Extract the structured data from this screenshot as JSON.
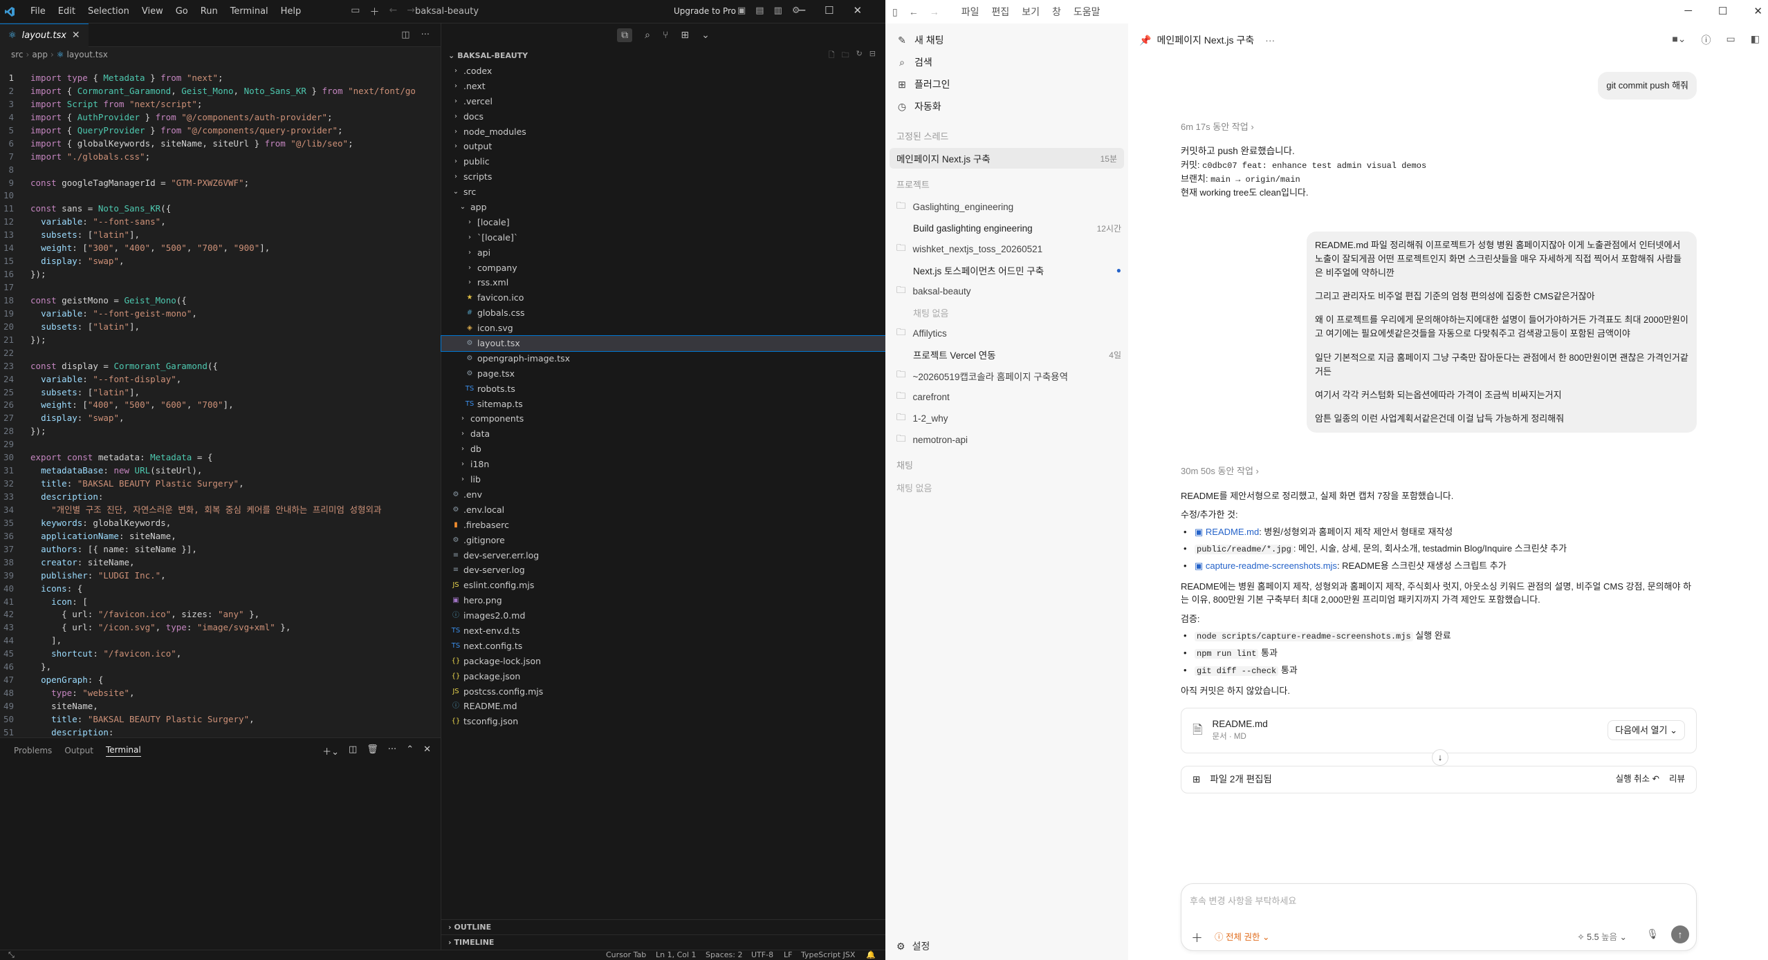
{
  "vscode": {
    "menu": [
      "File",
      "Edit",
      "Selection",
      "View",
      "Go",
      "Run",
      "Terminal",
      "Help"
    ],
    "window_title": "baksal-beauty",
    "upgrade": "Upgrade to Pro",
    "tab": "layout.tsx",
    "breadcrumb": [
      "src",
      "app",
      "layout.tsx"
    ],
    "code_lines": [
      "import type { Metadata } from \"next\";",
      "import { Cormorant_Garamond, Geist_Mono, Noto_Sans_KR } from \"next/font/go",
      "import Script from \"next/script\";",
      "import { AuthProvider } from \"@/components/auth-provider\";",
      "import { QueryProvider } from \"@/components/query-provider\";",
      "import { globalKeywords, siteName, siteUrl } from \"@/lib/seo\";",
      "import \"./globals.css\";",
      "",
      "const googleTagManagerId = \"GTM-PXWZ6VWF\";",
      "",
      "const sans = Noto_Sans_KR({",
      "  variable: \"--font-sans\",",
      "  subsets: [\"latin\"],",
      "  weight: [\"300\", \"400\", \"500\", \"700\", \"900\"],",
      "  display: \"swap\",",
      "});",
      "",
      "const geistMono = Geist_Mono({",
      "  variable: \"--font-geist-mono\",",
      "  subsets: [\"latin\"],",
      "});",
      "",
      "const display = Cormorant_Garamond({",
      "  variable: \"--font-display\",",
      "  subsets: [\"latin\"],",
      "  weight: [\"400\", \"500\", \"600\", \"700\"],",
      "  display: \"swap\",",
      "});",
      "",
      "export const metadata: Metadata = {",
      "  metadataBase: new URL(siteUrl),",
      "  title: \"BAKSAL BEAUTY Plastic Surgery\",",
      "  description:",
      "    \"개인별 구조 진단, 자연스러운 변화, 회복 중심 케어를 안내하는 프리미엄 성형외과 ",
      "  keywords: globalKeywords,",
      "  applicationName: siteName,",
      "  authors: [{ name: siteName }],",
      "  creator: siteName,",
      "  publisher: \"LUDGI Inc.\",",
      "  icons: {",
      "    icon: [",
      "      { url: \"/favicon.ico\", sizes: \"any\" },",
      "      { url: \"/icon.svg\", type: \"image/svg+xml\" },",
      "    ],",
      "    shortcut: \"/favicon.ico\",",
      "  },",
      "  openGraph: {",
      "    type: \"website\",",
      "    siteName,",
      "    title: \"BAKSAL BEAUTY Plastic Surgery\",",
      "    description:"
    ],
    "panel_tabs": [
      "Problems",
      "Output",
      "Terminal"
    ],
    "explorer_root": "BAKSAL-BEAUTY",
    "tree": [
      {
        "d": 0,
        "t": "f",
        "n": ".codex"
      },
      {
        "d": 0,
        "t": "f",
        "n": ".next"
      },
      {
        "d": 0,
        "t": "f",
        "n": ".vercel"
      },
      {
        "d": 0,
        "t": "f",
        "n": "docs"
      },
      {
        "d": 0,
        "t": "f",
        "n": "node_modules"
      },
      {
        "d": 0,
        "t": "f",
        "n": "output"
      },
      {
        "d": 0,
        "t": "f",
        "n": "public"
      },
      {
        "d": 0,
        "t": "f",
        "n": "scripts"
      },
      {
        "d": 0,
        "t": "o",
        "n": "src"
      },
      {
        "d": 1,
        "t": "o",
        "n": "app"
      },
      {
        "d": 2,
        "t": "f",
        "n": "[locale]"
      },
      {
        "d": 2,
        "t": "f",
        "n": "`[locale]`"
      },
      {
        "d": 2,
        "t": "f",
        "n": "api"
      },
      {
        "d": 2,
        "t": "f",
        "n": "company"
      },
      {
        "d": 2,
        "t": "f",
        "n": "rss.xml"
      },
      {
        "d": 2,
        "t": "s",
        "n": "favicon.ico"
      },
      {
        "d": 2,
        "t": "h",
        "n": "globals.css"
      },
      {
        "d": 2,
        "t": "v",
        "n": "icon.svg"
      },
      {
        "d": 2,
        "t": "g",
        "n": "layout.tsx",
        "sel": true
      },
      {
        "d": 2,
        "t": "g",
        "n": "opengraph-image.tsx"
      },
      {
        "d": 2,
        "t": "g",
        "n": "page.tsx"
      },
      {
        "d": 2,
        "t": "ts",
        "n": "robots.ts"
      },
      {
        "d": 2,
        "t": "ts",
        "n": "sitemap.ts"
      },
      {
        "d": 1,
        "t": "f",
        "n": "components"
      },
      {
        "d": 1,
        "t": "f",
        "n": "data"
      },
      {
        "d": 1,
        "t": "f",
        "n": "db"
      },
      {
        "d": 1,
        "t": "f",
        "n": "i18n"
      },
      {
        "d": 1,
        "t": "f",
        "n": "lib"
      },
      {
        "d": 0,
        "t": "g",
        "n": ".env"
      },
      {
        "d": 0,
        "t": "g",
        "n": ".env.local"
      },
      {
        "d": 0,
        "t": "b",
        "n": ".firebaserc"
      },
      {
        "d": 0,
        "t": "g",
        "n": ".gitignore"
      },
      {
        "d": 0,
        "t": "l",
        "n": "dev-server.err.log"
      },
      {
        "d": 0,
        "t": "l",
        "n": "dev-server.log"
      },
      {
        "d": 0,
        "t": "j",
        "n": "eslint.config.mjs"
      },
      {
        "d": 0,
        "t": "p",
        "n": "hero.png"
      },
      {
        "d": 0,
        "t": "m",
        "n": "images2.0.md"
      },
      {
        "d": 0,
        "t": "ts",
        "n": "next-env.d.ts"
      },
      {
        "d": 0,
        "t": "ts",
        "n": "next.config.ts"
      },
      {
        "d": 0,
        "t": "k",
        "n": "package-lock.json"
      },
      {
        "d": 0,
        "t": "k",
        "n": "package.json"
      },
      {
        "d": 0,
        "t": "j",
        "n": "postcss.config.mjs"
      },
      {
        "d": 0,
        "t": "m",
        "n": "README.md"
      },
      {
        "d": 0,
        "t": "k",
        "n": "tsconfig.json"
      }
    ],
    "outline": "OUTLINE",
    "timeline": "TIMELINE",
    "status": {
      "cursor_tab": "Cursor Tab",
      "pos": "Ln 1, Col 1",
      "spaces": "Spaces: 2",
      "enc": "UTF-8",
      "eol": "LF",
      "lang": "TypeScript JSX"
    }
  },
  "codex": {
    "menu": [
      "파일",
      "편집",
      "보기",
      "창",
      "도움말"
    ],
    "sidebar": {
      "new_chat": "새 채팅",
      "search": "검색",
      "plugins": "플러그인",
      "automation": "자동화",
      "pinned_label": "고정된 스레드",
      "pinned_thread": "메인페이지 Next.js 구축",
      "pinned_time": "15분",
      "projects_label": "프로젝트",
      "projects": [
        {
          "name": "Gaslighting_engineering",
          "threads": [
            {
              "t": "Build gaslighting engineering",
              "time": "12시간"
            }
          ]
        },
        {
          "name": "wishket_nextjs_toss_20260521",
          "threads": [
            {
              "t": "Next.js 토스페이먼츠 어드민 구축",
              "time": "",
              "dot": true
            }
          ]
        },
        {
          "name": "baksal-beauty",
          "threads": [],
          "empty": "채팅 없음"
        },
        {
          "name": "Affilytics",
          "threads": [
            {
              "t": "프로젝트 Vercel 연동",
              "time": "4일"
            }
          ]
        },
        {
          "name": "~20260519캡코솔라 홈페이지 구축용역",
          "threads": []
        },
        {
          "name": "carefront",
          "threads": []
        },
        {
          "name": "1-2_why",
          "threads": []
        },
        {
          "name": "nemotron-api",
          "threads": []
        }
      ],
      "chats_label": "채팅",
      "chats_empty": "채팅 없음",
      "settings": "설정"
    },
    "header_title": "메인페이지 Next.js 구축",
    "msg1": "git commit push 해줘",
    "worked1": "6m 17s 동안 작업",
    "r1_line1": "커밋하고 push 완료했습니다.",
    "r1_commit_label": "커밋: ",
    "r1_commit": "c0dbc07 feat: enhance test admin visual demos",
    "r1_branch_label": "브랜치: ",
    "r1_branch": "main → origin/main",
    "r1_line4": "현재 working tree도 clean입니다.",
    "msg2": [
      "README.md 파일 정리해줘 이프로젝트가 성형 병원 홈페이지잖아 이게 노출관점에서 인터넷에서 노출이 잘되게끔 어떤 프로젝트인지 화면 스크린샷들을 매우 자세하게 직접 찍어서 포함해줘 사람들은 비주얼에 약하니깐",
      "그리고 관리자도 비주얼 편집 기준의 엄청 편의성에 집중한 CMS같은거잖아",
      "왜 이 프로젝트를 우리에게 문의해야하는지에대한 설명이 들어가야하거든 가격표도 최대 2000만원이고 여기에는 필요에셋같은것들을 자동으로 다맞춰주고 검색광고등이 포함된 금액이야",
      "일단 기본적으로 지금 홈페이지 그냥 구축만 잡아둔다는 관점에서 한 800만원이면 괜찮은 가격인거같거든",
      "여기서 각각 커스텀화 되는옵션에따라 가격이 조금씩 비싸지는거지",
      "암튼 일종의 이런 사업계획서같은건데 이걸 납득 가능하게 정리해줘"
    ],
    "worked2": "30m 50s 동안 작업",
    "r2_intro": "README를 제안서형으로 정리했고, 실제 화면 캡처 7장을 포함했습니다.",
    "r2_changes": "수정/추가한 것:",
    "r2_b1_link": "README.md",
    "r2_b1_text": ": 병원/성형외과 홈페이지 제작 제안서 형태로 재작성",
    "r2_b2_code": "public/readme/*.jpg",
    "r2_b2_text": ": 메인, 시술, 상세, 문의, 회사소개, testadmin Blog/Inquire 스크린샷 추가",
    "r2_b3_link": "capture-readme-screenshots.mjs",
    "r2_b3_text": ": README용 스크린샷 재생성 스크립트 추가",
    "r2_para": "README에는 병원 홈페이지 제작, 성형외과 홈페이지 제작, 주식회사 럿지, 아웃소싱 키워드 관점의 설명, 비주얼 CMS 강점, 문의해야 하는 이유, 800만원 기본 구축부터 최대 2,000만원 프리미엄 패키지까지 가격 제안도 포함했습니다.",
    "r2_verify": "검증:",
    "r2_v1_code": "node scripts/capture-readme-screenshots.mjs",
    "r2_v1_text": " 실행 완료",
    "r2_v2_code": "npm run lint",
    "r2_v2_text": " 통과",
    "r2_v3_code": "git diff --check",
    "r2_v3_text": " 통과",
    "r2_end": "아직 커밋은 하지 않았습니다.",
    "file_card": {
      "name": "README.md",
      "meta": "문서 · MD",
      "open": "다음에서 열기"
    },
    "edit_card": {
      "title": "파일 2개 편집됨",
      "undo": "실행 취소 ↶",
      "review": "리뷰"
    },
    "composer": {
      "placeholder": "후속 변경 사항을 부탁하세요",
      "perm": "전체 권한",
      "model": "5.5",
      "effort": "높음"
    },
    "colors": {
      "accent": "#2563c9",
      "warn": "#e06c1c"
    }
  }
}
